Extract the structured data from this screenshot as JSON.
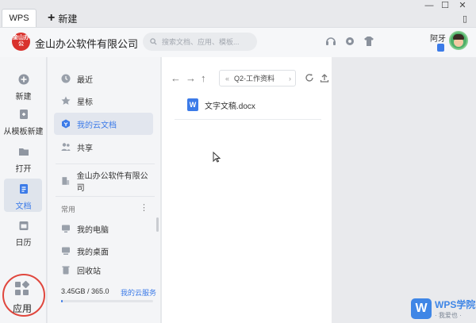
{
  "tabs": {
    "wps": "WPS",
    "new_label": "新建"
  },
  "window": {
    "icons": [
      "minimize-icon",
      "maximize-icon",
      "close-icon",
      "panel-icon"
    ]
  },
  "header": {
    "logo_text": "金山办公",
    "company": "金山办公软件有限公司",
    "search_placeholder": "搜索文档、应用、模板...",
    "user_name": "阿牙"
  },
  "leftnav": {
    "items": [
      {
        "label": "新建",
        "icon": "plus-circle-icon"
      },
      {
        "label": "从模板新建",
        "icon": "template-icon"
      },
      {
        "label": "打开",
        "icon": "folder-icon"
      },
      {
        "label": "文档",
        "icon": "document-icon"
      },
      {
        "label": "日历",
        "icon": "calendar-icon"
      }
    ],
    "apps_label": "应用"
  },
  "sidebar": {
    "items": [
      {
        "label": "最近",
        "icon": "clock-icon"
      },
      {
        "label": "星标",
        "icon": "star-icon"
      },
      {
        "label": "我的云文档",
        "icon": "cloud-doc-icon",
        "active": true
      },
      {
        "label": "共享",
        "icon": "share-icon"
      }
    ],
    "org": "金山办公软件有限公司",
    "common_label": "常用",
    "common_items": [
      "我的电脑",
      "我的桌面",
      "回收站"
    ],
    "storage_text": "3.45GB / 365.0",
    "storage_link": "我的云服务"
  },
  "main": {
    "path": "Q2-工作资料",
    "files": [
      {
        "name": "文字文稿.docx",
        "icon": "word-icon",
        "icon_letter": "W"
      }
    ]
  },
  "watermark": {
    "title": "WPS学院",
    "subtitle": "· 我爱也 ·"
  },
  "colors": {
    "accent": "#3c7be8",
    "highlight_ring": "#e0473e",
    "brand_red": "#d9322d"
  }
}
